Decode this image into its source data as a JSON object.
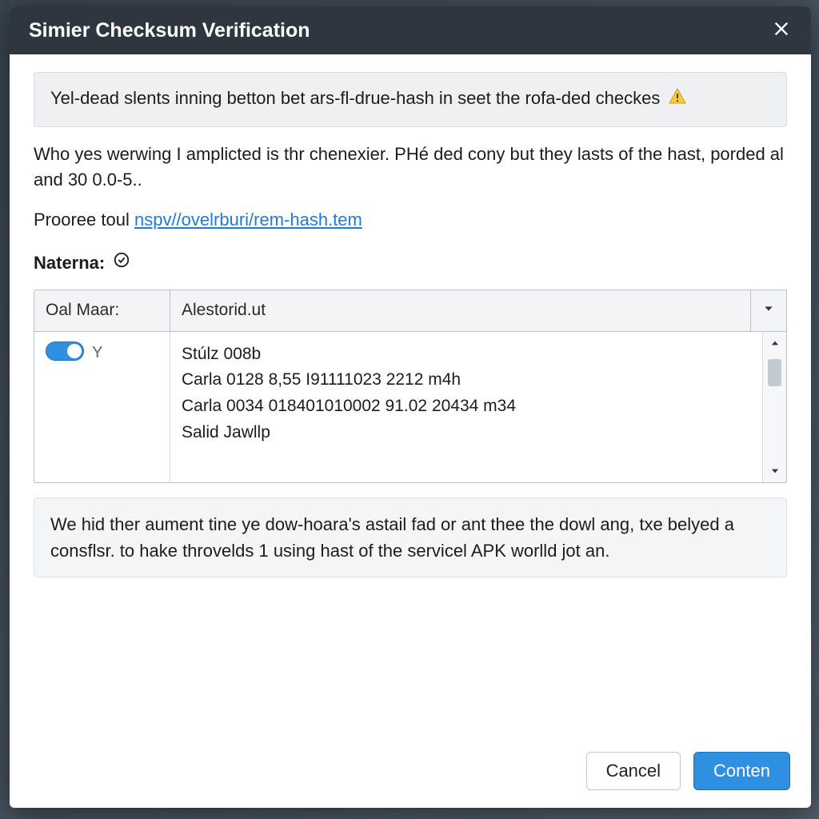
{
  "dialog": {
    "title": "Simier Checksum Verification",
    "alert_text": "Yel-dead slents inning betton bet ars-fl-drue-hash in seet the rofa-ded checkes",
    "paragraph": "Who yes werwing I amplicted is thr chenexier. PHé ded cony but they lasts of the hast, porded al and 30 0.0-5..",
    "link_prefix": "Prooree toul ",
    "link_text": "nspv//ovelrburi/rem-hash.tem",
    "section_label": "Naterna:",
    "table": {
      "headers": {
        "col1": "Oal Maar:",
        "col2": "Alestorid.ut"
      },
      "row1_y": "Y",
      "lines": [
        "Stúlz 008b",
        "Carla 0128 8,55 I91111023 2212 m4h",
        "Carla 0034 018401010002 91.02 20434 m34",
        "Salid Jawllp"
      ]
    },
    "info_text": "We hid ther aument tine ye dow-hoara's astail fad or ant thee the dowl ang, txe belyed a consflsr. to hake throvelds 1 using hast of the servicel APK worlld jot an.",
    "buttons": {
      "cancel": "Cancel",
      "continue": "Conten"
    }
  }
}
